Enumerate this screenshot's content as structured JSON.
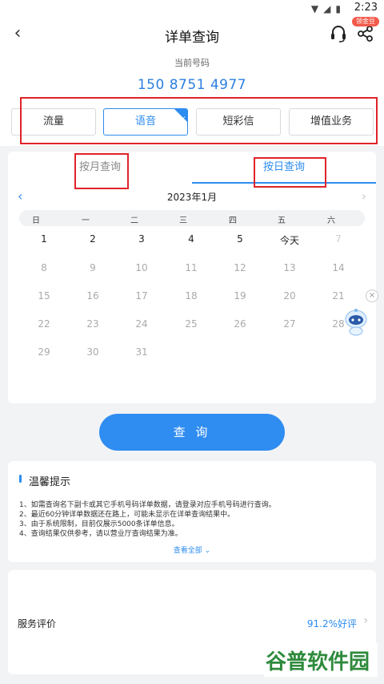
{
  "status_bar": {
    "time": "2:23"
  },
  "header": {
    "title": "详单查询",
    "badge": "领金豆"
  },
  "account": {
    "label": "当前号码",
    "number": "150 8751 4977"
  },
  "type_tabs": [
    {
      "label": "流量"
    },
    {
      "label": "语音"
    },
    {
      "label": "短彩信"
    },
    {
      "label": "增值业务"
    }
  ],
  "mode_tabs": [
    {
      "label": "按月查询"
    },
    {
      "label": "按日查询"
    }
  ],
  "calendar": {
    "month": "2023年1月",
    "weekdays": [
      "日",
      "一",
      "二",
      "三",
      "四",
      "五",
      "六"
    ],
    "rows": [
      [
        "1",
        "2",
        "3",
        "4",
        "5",
        "今天",
        "7"
      ],
      [
        "8",
        "9",
        "10",
        "11",
        "12",
        "13",
        "14"
      ],
      [
        "15",
        "16",
        "17",
        "18",
        "19",
        "20",
        "21"
      ],
      [
        "22",
        "23",
        "24",
        "25",
        "26",
        "27",
        "28"
      ],
      [
        "29",
        "30",
        "31"
      ]
    ]
  },
  "query_button": "查 询",
  "tips": {
    "title": "温馨提示",
    "lines": [
      "1、如需查询名下副卡或其它手机号码详单数据，请登录对应手机号码进行查询。",
      "2、最近60分钟详单数据还在路上，可能未显示在详单查询结果中。",
      "3、由于系统限制，目前仅展示5000条详单信息。",
      "4、查询结果仅供参考，请以营业厅查询结果为准。"
    ],
    "more": "查看全部 ⌄"
  },
  "evaluation": {
    "label": "服务评价",
    "value": "91.2%好评"
  },
  "watermark": {
    "text": "谷普软件园"
  },
  "colors": {
    "accent": "#2d8cf0",
    "highlight_box": "#e0232a",
    "badge": "#f25a4a"
  }
}
